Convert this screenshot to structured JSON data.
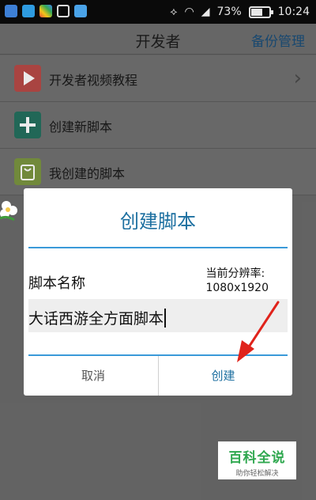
{
  "status_bar": {
    "battery_percent": "73%",
    "battery_level": 0.73,
    "time": "10:24"
  },
  "app_bar": {
    "title": "开发者",
    "backup_link": "备份管理"
  },
  "menu": {
    "items": [
      {
        "label": "开发者视频教程",
        "icon": "play-icon",
        "color": "#d9534f"
      },
      {
        "label": "创建新脚本",
        "icon": "plus-icon",
        "color": "#1e8a6e"
      },
      {
        "label": "我创建的脚本",
        "icon": "bag-icon",
        "color": "#8ab93e"
      }
    ]
  },
  "dialog": {
    "title": "创建脚本",
    "name_label": "脚本名称",
    "resolution_label": "当前分辨率:",
    "resolution_value": "1080x1920",
    "input_value": "大话西游全方面脚本",
    "cancel_label": "取消",
    "create_label": "创建"
  },
  "watermark": {
    "title": "百科全说",
    "subtitle": "助你轻松解决"
  },
  "colors": {
    "accent": "#1c6fa0",
    "divider": "#3a9ad9",
    "annotation_arrow": "#e0231b"
  }
}
